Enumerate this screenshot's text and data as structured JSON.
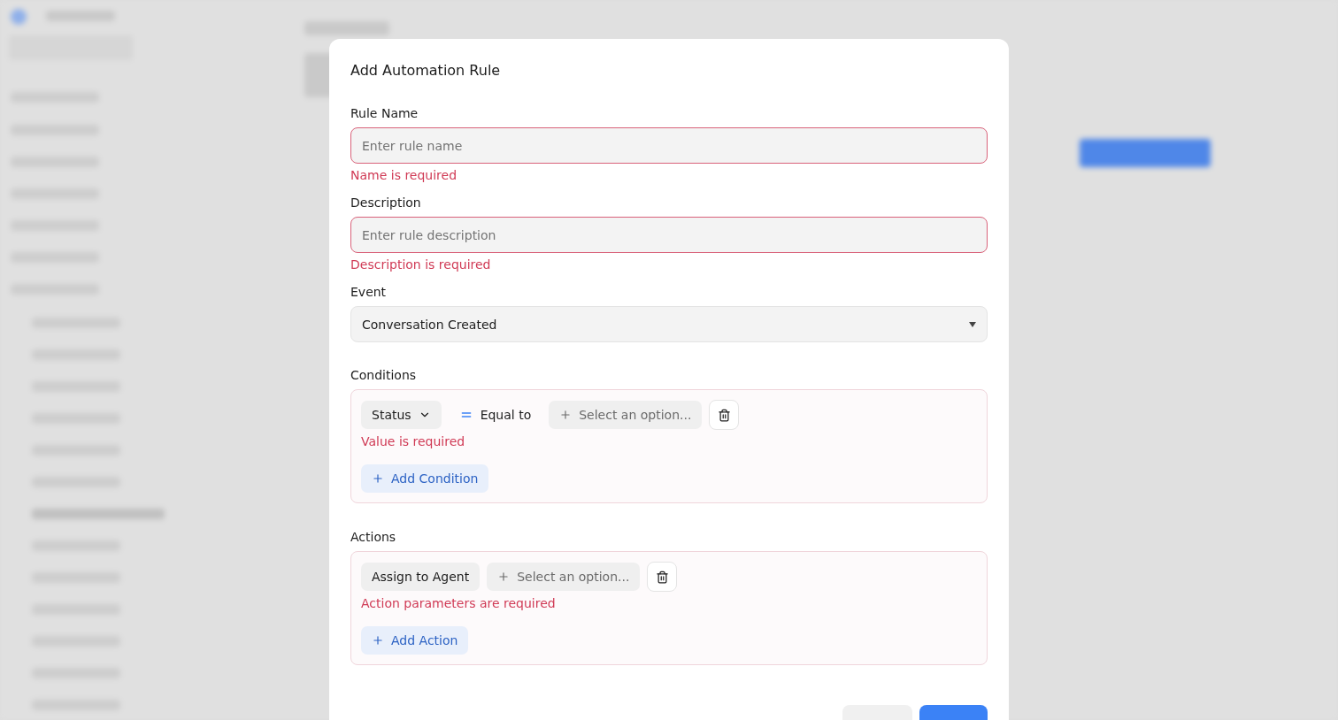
{
  "dialog": {
    "title": "Add Automation Rule",
    "fields": [
      {
        "kind": "input",
        "label": "Rule Name",
        "placeholder": "Enter rule name",
        "invalid": true,
        "error": "Name is required"
      },
      {
        "kind": "input",
        "label": "Description",
        "placeholder": "Enter rule description",
        "invalid": true,
        "error": "Description is required"
      },
      {
        "kind": "select",
        "label": "Event",
        "value": "Conversation Created"
      }
    ],
    "conditions": {
      "label": "Conditions",
      "rows": [
        {
          "attribute": "Status",
          "operator": "Equal to",
          "value_placeholder": "Select an option...",
          "error": "Value is required"
        }
      ],
      "add_button": "Add Condition"
    },
    "actions": {
      "label": "Actions",
      "rows": [
        {
          "action": "Assign to Agent",
          "value_placeholder": "Select an option...",
          "error": "Action parameters are required"
        }
      ],
      "add_button": "Add Action"
    }
  }
}
